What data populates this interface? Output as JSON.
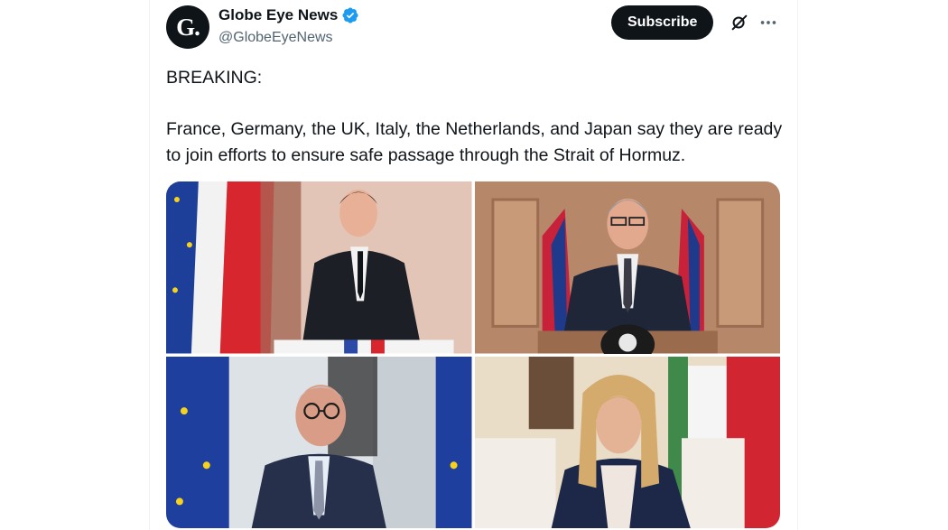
{
  "author": {
    "display_name": "Globe Eye News",
    "handle": "@GlobeEyeNews",
    "avatar_letter": "G.",
    "verified": true,
    "verified_color": "#1d9bf0"
  },
  "actions": {
    "subscribe_label": "Subscribe",
    "grok_icon": "grok-icon",
    "more_icon": "more-icon"
  },
  "tweet": {
    "line1": "BREAKING:",
    "line2": "France, Germany, the UK, Italy, the Netherlands, and Japan say they are ready to join efforts to ensure safe passage through the Strait of Hormuz."
  },
  "media": [
    {
      "name": "photo-top-left",
      "subject": "leader at podium with French and EU flags"
    },
    {
      "name": "photo-top-right",
      "subject": "leader at lectern with UK flags"
    },
    {
      "name": "photo-bottom-left",
      "subject": "leader with glasses beside EU flags"
    },
    {
      "name": "photo-bottom-right",
      "subject": "leader seated with Italian flag"
    }
  ],
  "colors": {
    "text": "#0f1419",
    "secondary": "#536471",
    "button_bg": "#0f1419"
  }
}
